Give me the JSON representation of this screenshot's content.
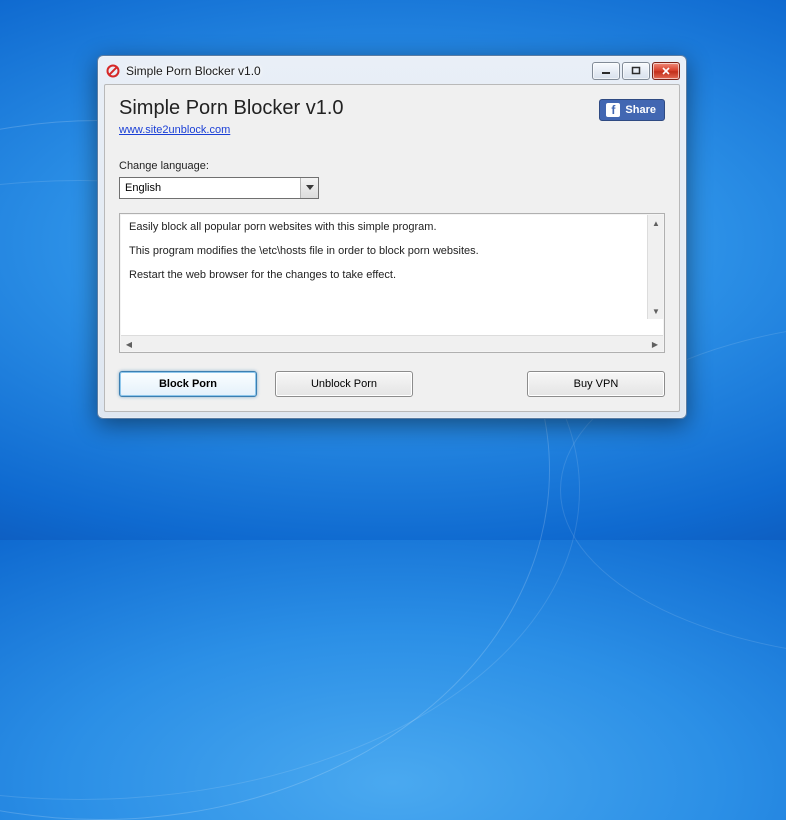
{
  "window": {
    "title": "Simple Porn Blocker v1.0"
  },
  "header": {
    "title": "Simple Porn Blocker v1.0",
    "link": "www.site2unblock.com",
    "share_label": "Share"
  },
  "language": {
    "label": "Change language:",
    "selected": "English"
  },
  "description": {
    "line1": "Easily block all popular porn websites with this simple program.",
    "line2": "This program modifies the \\etc\\hosts file in order to block porn websites.",
    "line3": "Restart the web browser for the changes to take effect."
  },
  "buttons": {
    "block": "Block Porn",
    "unblock": "Unblock Porn",
    "buy_vpn": "Buy VPN"
  }
}
